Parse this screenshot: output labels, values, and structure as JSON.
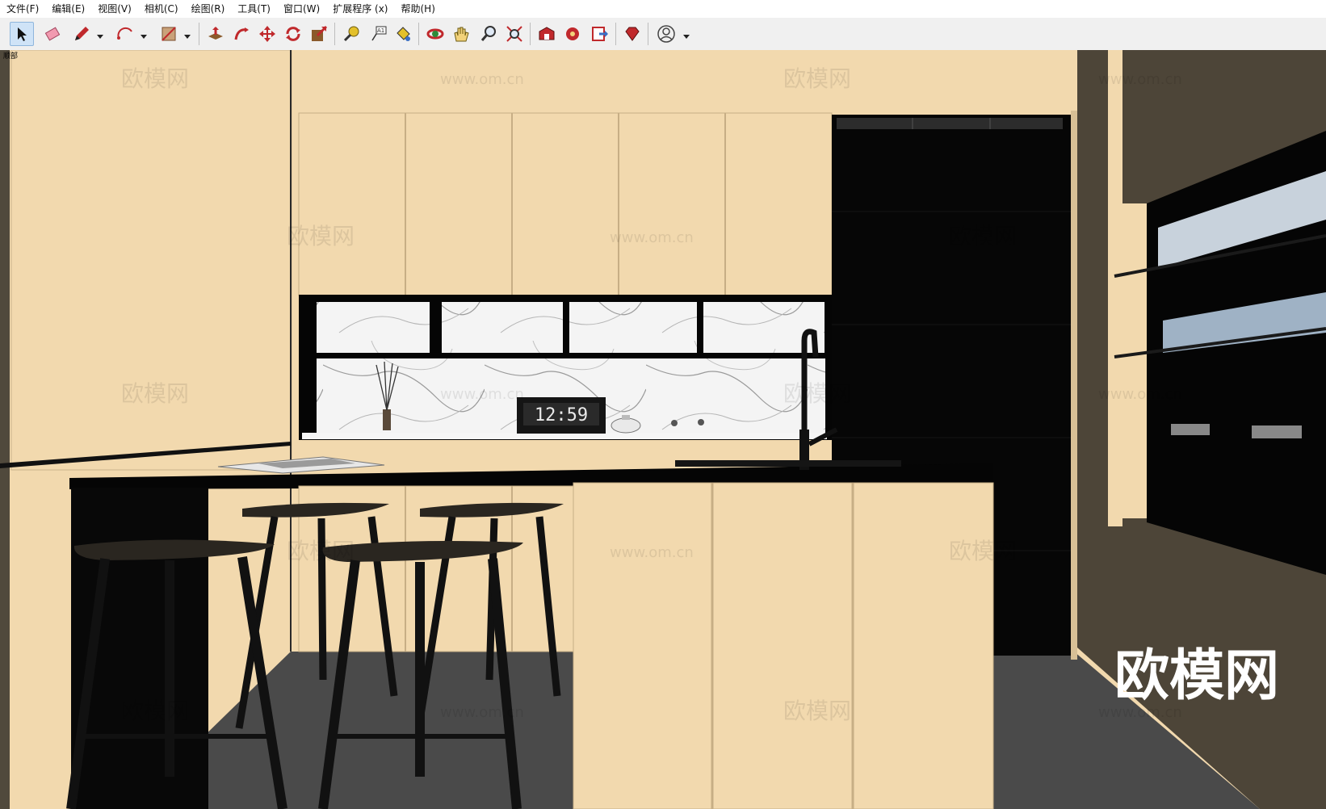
{
  "menu": [
    {
      "label": "文件(F)"
    },
    {
      "label": "编辑(E)"
    },
    {
      "label": "视图(V)"
    },
    {
      "label": "相机(C)"
    },
    {
      "label": "绘图(R)"
    },
    {
      "label": "工具(T)"
    },
    {
      "label": "窗口(W)"
    },
    {
      "label": "扩展程序 (x)"
    },
    {
      "label": "帮助(H)"
    }
  ],
  "scene_tab": "顺部",
  "toolbar_icons": [
    "select-icon",
    "eraser-icon",
    "pencil-icon",
    "arc-icon",
    "shape-icon",
    "pushpull-icon",
    "followme-icon",
    "move-icon",
    "rotate-icon",
    "scale-icon",
    "tape-measure-icon",
    "text-label-icon",
    "paint-bucket-icon",
    "orbit-icon",
    "pan-icon",
    "zoom-icon",
    "zoom-extents-icon",
    "warehouse-icon",
    "extension-warehouse-icon",
    "send-to-layout-icon",
    "ruby-icon",
    "user-account-icon"
  ],
  "scene": {
    "clock_time": "12:59",
    "watermark_text": "欧模网",
    "watermark_url": "www.om.cn",
    "logo_text": "欧模网",
    "colors": {
      "wood": "#f2d9ae",
      "black": "#050505",
      "marble": "#f4f4f4",
      "floor": "#4a4a4a",
      "side_wall": "#4d4538"
    }
  }
}
